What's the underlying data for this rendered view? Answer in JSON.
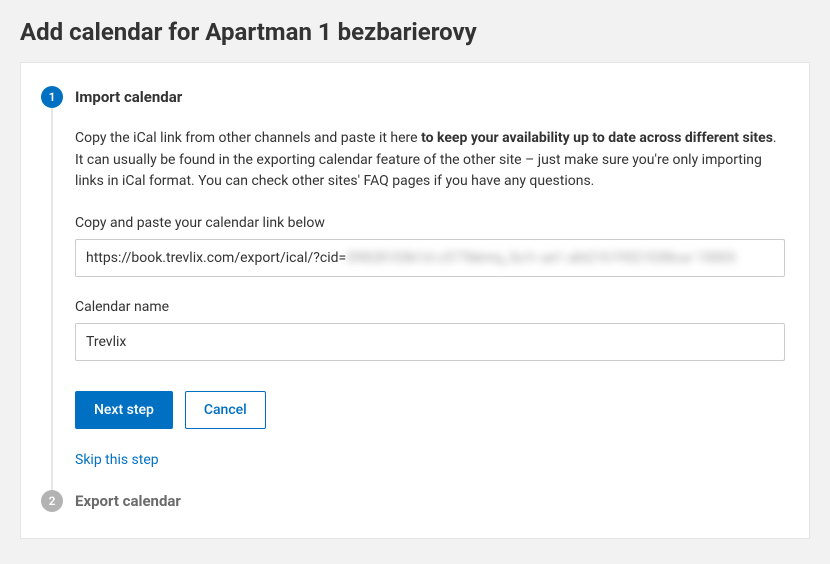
{
  "page": {
    "title": "Add calendar for Apartman 1 bezbarierovy"
  },
  "steps": {
    "import": {
      "number": "1",
      "title": "Import calendar",
      "desc_pre": "Copy the iCal link from other channels and paste it here ",
      "desc_strong": "to keep your availability up to date across different sites",
      "desc_post": ". It can usually be found in the exporting calendar feature of the other site – just make sure you're only importing links in iCal format. You can check other sites' FAQ pages if you have any questions.",
      "url_label": "Copy and paste your calendar link below",
      "url_value_visible": "https://book.trevlix.com/export/ical/?cid=",
      "url_value_obscured": "39828103b1d c377bkmq_3u1r ue1 ubt210 FI021038cur 15003",
      "name_label": "Calendar name",
      "name_value": "Trevlix",
      "next_button": "Next step",
      "cancel_button": "Cancel",
      "skip_link": "Skip this step"
    },
    "export": {
      "number": "2",
      "title": "Export calendar"
    }
  }
}
